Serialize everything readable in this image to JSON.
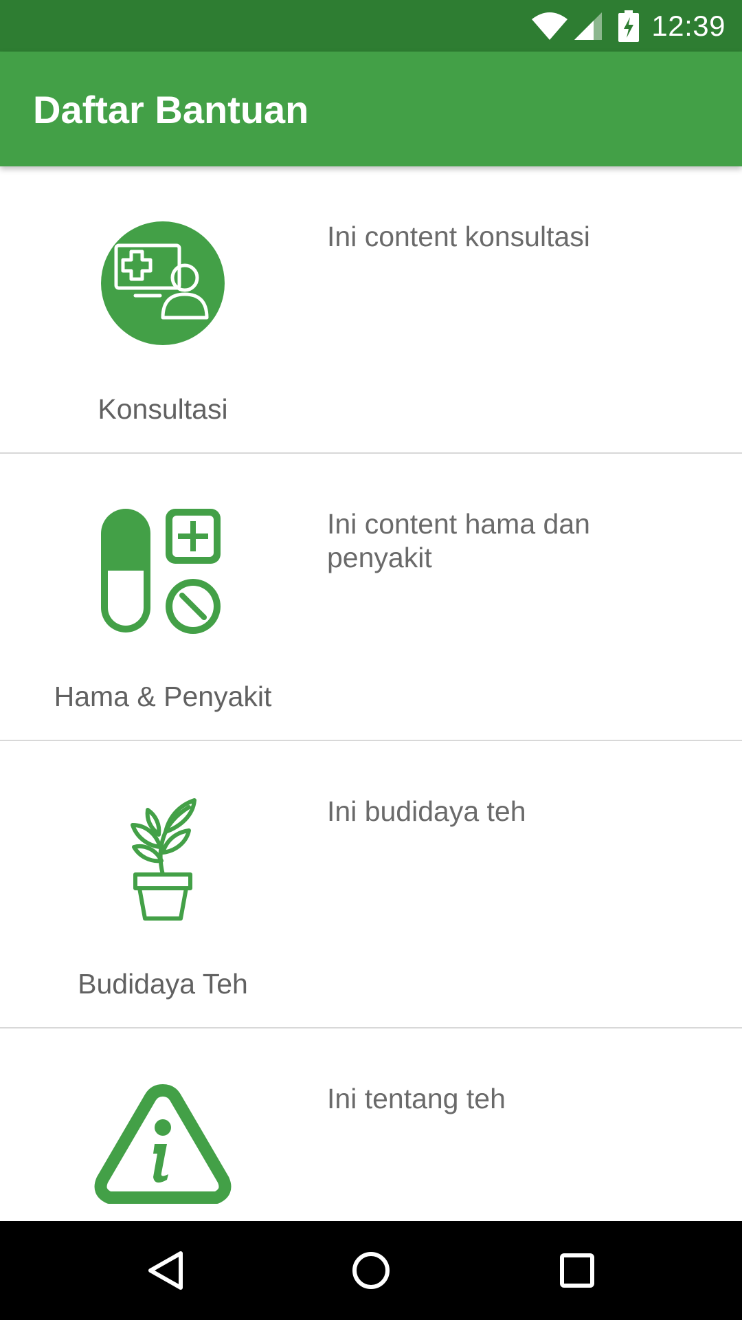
{
  "status_bar": {
    "time": "12:39",
    "icons": [
      "wifi-icon",
      "cell-signal-icon",
      "battery-charging-icon"
    ]
  },
  "app_bar": {
    "title": "Daftar Bantuan"
  },
  "items": [
    {
      "label": "Konsultasi",
      "content": "Ini content konsultasi",
      "icon": "consultation-icon"
    },
    {
      "label": "Hama & Penyakit",
      "content": "Ini content hama dan penyakit",
      "icon": "pests-diseases-icon"
    },
    {
      "label": "Budidaya Teh",
      "content": "Ini budidaya teh",
      "icon": "potted-plant-icon"
    },
    {
      "label": "",
      "content": "Ini tentang teh",
      "icon": "info-triangle-icon"
    }
  ],
  "nav_bar": {
    "buttons": [
      "back-icon",
      "home-icon",
      "recents-icon"
    ]
  },
  "colors": {
    "status_bar": "#2e7d32",
    "app_bar": "#43a047",
    "icon_green": "#43a047",
    "label_text": "#616161",
    "content_text": "#6a6a6a",
    "nav_bar": "#000000"
  }
}
